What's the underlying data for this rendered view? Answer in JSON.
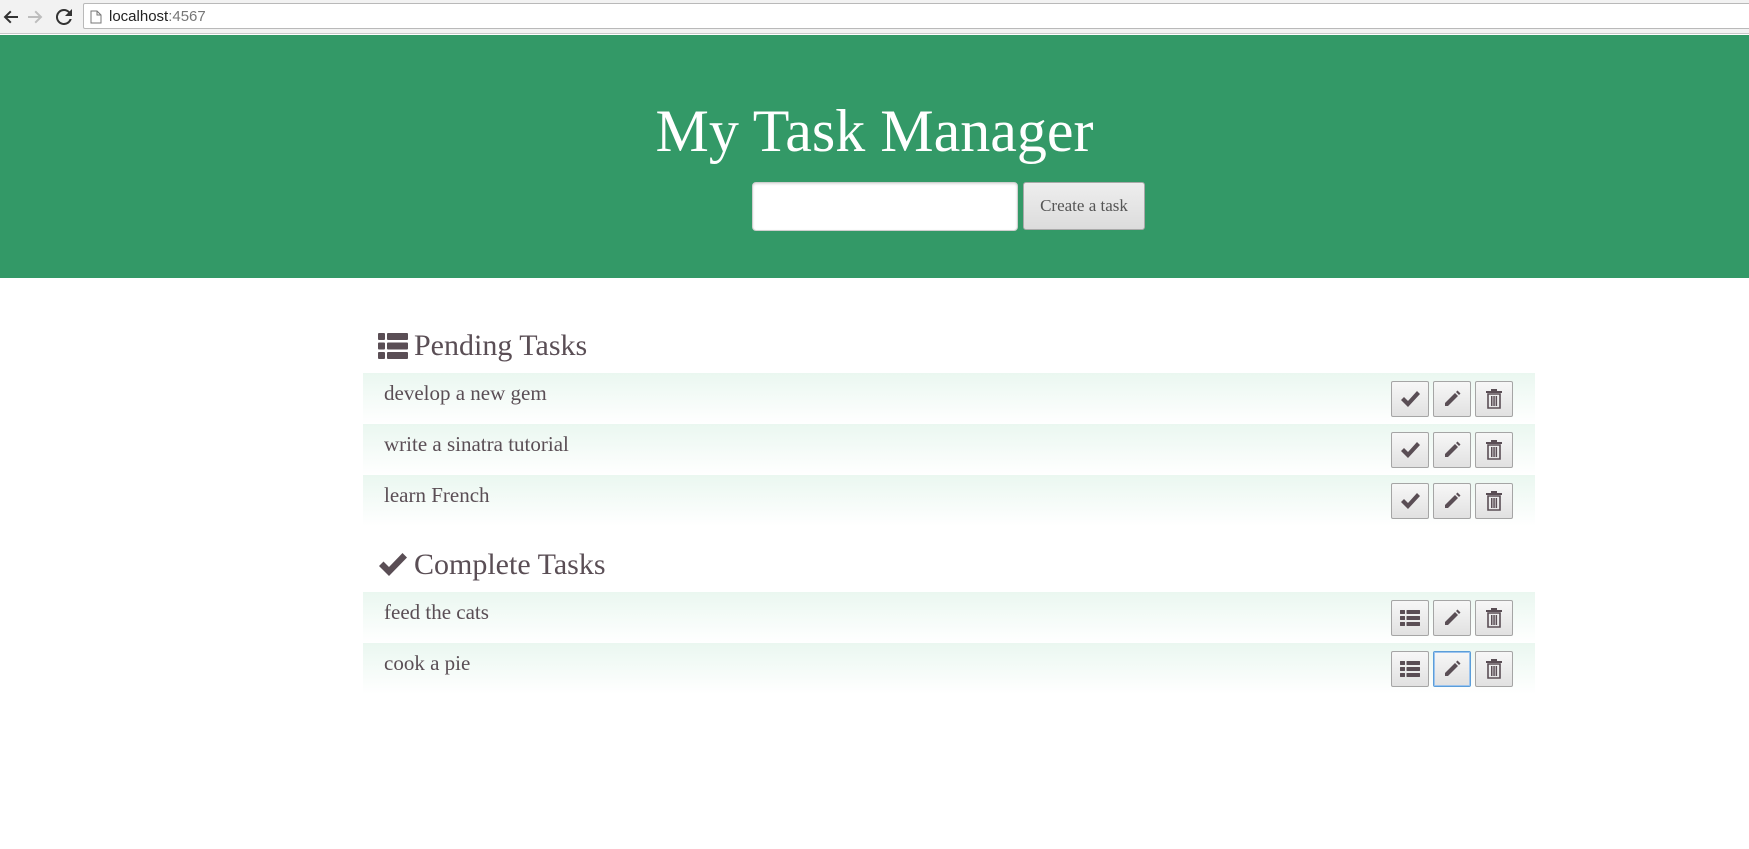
{
  "browser": {
    "url_host": "localhost",
    "url_port": ":4567",
    "icons": [
      "back-arrow-icon",
      "forward-arrow-icon",
      "reload-icon",
      "page-icon"
    ]
  },
  "header": {
    "title": "My Task Manager",
    "input_value": "",
    "create_label": "Create a task",
    "background_color": "#339967"
  },
  "pending": {
    "heading": "Pending Tasks",
    "icon": "list-icon",
    "tasks": [
      {
        "label": "develop a new gem"
      },
      {
        "label": "write a sinatra tutorial"
      },
      {
        "label": "learn French"
      }
    ],
    "action_icons": [
      "check-icon",
      "pencil-icon",
      "trash-icon"
    ]
  },
  "complete": {
    "heading": "Complete Tasks",
    "icon": "check-icon",
    "tasks": [
      {
        "label": "feed the cats"
      },
      {
        "label": "cook a pie"
      }
    ],
    "action_icons": [
      "list-icon",
      "pencil-icon",
      "trash-icon"
    ]
  },
  "colors": {
    "text": "#5a4e55",
    "row_tint": "#eaf7f0",
    "focus_ring": "#5b9dd9"
  }
}
